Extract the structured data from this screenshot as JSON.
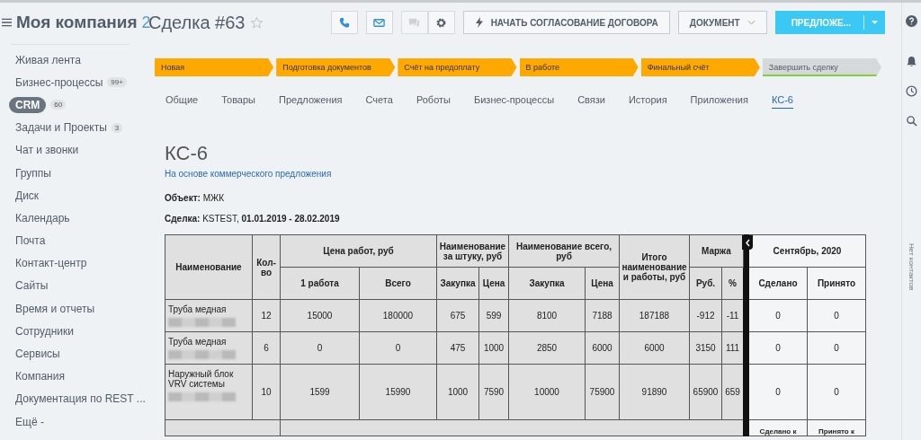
{
  "header": {
    "company": "Моя компания",
    "company_counter": "2",
    "title": "Сделка #63",
    "buttons": [
      {
        "kind": "phone"
      },
      {
        "kind": "mail"
      },
      {
        "kind": "chat",
        "disabled": true
      },
      {
        "kind": "gear"
      },
      {
        "kind": "text",
        "label": "НАЧАТЬ СОГЛАСОВАНИЕ ДОГОВОРА"
      },
      {
        "kind": "dropdown",
        "label": "ДОКУМЕНТ"
      },
      {
        "kind": "split",
        "label": "ПРЕДЛОЖЕ..."
      }
    ]
  },
  "sidebar": {
    "items": [
      {
        "label": "Живая лента",
        "selected": false
      },
      {
        "label": "Бизнес-процессы",
        "counter": "99+",
        "selected": false
      },
      {
        "label": "CRM",
        "counter": "60",
        "selected": true
      },
      {
        "label": "Задачи и Проекты",
        "counter": "3",
        "selected": false
      },
      {
        "label": "Чат и звонки",
        "selected": false
      },
      {
        "label": "Группы",
        "selected": false
      },
      {
        "label": "Диск",
        "selected": false
      },
      {
        "label": "Календарь",
        "selected": false
      },
      {
        "label": "Почта",
        "selected": false
      },
      {
        "label": "Контакт-центр",
        "selected": false
      },
      {
        "label": "Сайты",
        "selected": false
      },
      {
        "label": "Время и отчеты",
        "selected": false
      },
      {
        "label": "Сотрудники",
        "selected": false
      },
      {
        "label": "Сервисы",
        "selected": false
      },
      {
        "label": "Компания",
        "selected": false
      },
      {
        "label": "Документация по REST ...",
        "selected": false
      },
      {
        "label": "Ещё -",
        "selected": false
      }
    ]
  },
  "stages": [
    {
      "label": "Новая",
      "done": true
    },
    {
      "label": "Подготовка документов",
      "done": true
    },
    {
      "label": "Счёт на предоплату",
      "done": true
    },
    {
      "label": "В работе",
      "done": true
    },
    {
      "label": "Финальный счёт",
      "done": true
    },
    {
      "label": "Завершить сделку",
      "done": false
    }
  ],
  "tabs": [
    {
      "label": "Общие",
      "selected": false
    },
    {
      "label": "Товары",
      "selected": false
    },
    {
      "label": "Предложения",
      "selected": false
    },
    {
      "label": "Счета",
      "selected": false
    },
    {
      "label": "Роботы",
      "selected": false
    },
    {
      "label": "Бизнес-процессы",
      "selected": false
    },
    {
      "label": "Связи",
      "selected": false
    },
    {
      "label": "История",
      "selected": false
    },
    {
      "label": "Приложения",
      "selected": false
    },
    {
      "label": "КС-6",
      "selected": true
    }
  ],
  "document": {
    "title": "КС-6",
    "subtitle_link": "На основе коммерческого предложения",
    "object_label": "Объект:",
    "object_value": "МЖК",
    "deal_label": "Сделка:",
    "deal_value": "KSTEST,",
    "deal_dates": "01.01.2019 - 28.02.2019"
  },
  "table": {
    "header_top": [
      "Наименование",
      "Кол-во",
      "Цена работ, руб",
      "Наименование за штуку, руб",
      "Наименование всего, руб",
      "Итого наименование и работы, руб",
      "Маржа"
    ],
    "header_sub": [
      "1 работа",
      "Всего",
      "Закупка",
      "Цена",
      "Закупка",
      "Цена",
      "Руб.",
      "%"
    ],
    "period": "Сентябрь, 2020",
    "period_sub": [
      "Сделано",
      "Принято"
    ],
    "rows": [
      {
        "cells": [
          "Труба медная",
          "12",
          "15000",
          "180000",
          "675",
          "599",
          "8100",
          "7188",
          "187188",
          "-912",
          "-11"
        ],
        "period_cells": [
          "0",
          "0"
        ]
      },
      {
        "cells": [
          "Труба медная",
          "6",
          "0",
          "0",
          "475",
          "1000",
          "2850",
          "6000",
          "6000",
          "3150",
          "111"
        ],
        "period_cells": [
          "0",
          "0"
        ]
      },
      {
        "cells": [
          "Наружный блок VRV системы",
          "10",
          "1599",
          "15990",
          "1000",
          "7590",
          "10000",
          "75900",
          "91890",
          "65900",
          "659"
        ],
        "period_cells": [
          "0",
          "0"
        ]
      }
    ],
    "footer_period_cells": [
      "Сделано к",
      "Принято к"
    ]
  },
  "right_panel": {
    "empty_text": "Нет контактов"
  }
}
